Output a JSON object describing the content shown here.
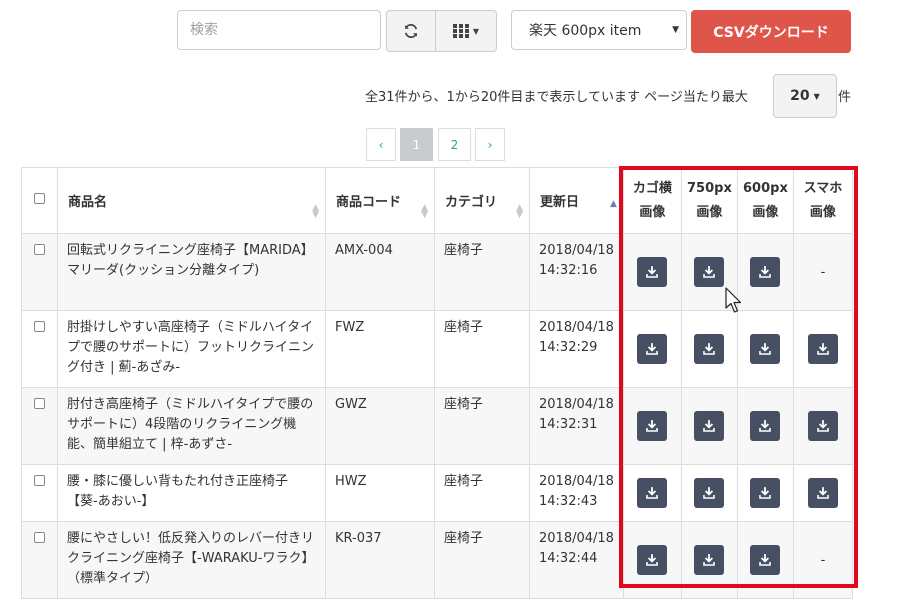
{
  "toolbar": {
    "search_placeholder": "検索",
    "refresh_icon": "refresh-icon",
    "columns_icon": "grid-icon",
    "select_value": "楽天 600px item",
    "csv_button": "CSVダウンロード"
  },
  "info": {
    "text": "全31件から、1から20件目まで表示しています ページ当たり最大",
    "page_size": "20",
    "suffix": "件"
  },
  "pagination": {
    "prev": "‹",
    "pages": [
      "1",
      "2"
    ],
    "next": "›",
    "active": "1"
  },
  "table": {
    "headers": {
      "name": "商品名",
      "code": "商品コード",
      "category": "カテゴリ",
      "updated": "更新日",
      "cart": [
        "カゴ横",
        "画像"
      ],
      "w750": [
        "750px",
        "画像"
      ],
      "w600": [
        "600px",
        "画像"
      ],
      "sp": [
        "スマホ",
        "画像"
      ]
    },
    "rows": [
      {
        "name": "回転式リクライニング座椅子【MARIDA】マリーダ(クッション分離タイプ)",
        "code": "AMX-004",
        "category": "座椅子",
        "date": "2018/04/18",
        "time": "14:32:16",
        "images": [
          true,
          true,
          true,
          false
        ]
      },
      {
        "name": "肘掛けしやすい高座椅子（ミドルハイタイプで腰のサポートに）フットリクライニング付き | 薊-あざみ-",
        "code": "FWZ",
        "category": "座椅子",
        "date": "2018/04/18",
        "time": "14:32:29",
        "images": [
          true,
          true,
          true,
          true
        ]
      },
      {
        "name": "肘付き高座椅子（ミドルハイタイプで腰のサポートに）4段階のリクライニング機能、簡単組立て | 梓-あずさ-",
        "code": "GWZ",
        "category": "座椅子",
        "date": "2018/04/18",
        "time": "14:32:31",
        "images": [
          true,
          true,
          true,
          true
        ]
      },
      {
        "name": "腰・膝に優しい背もたれ付き正座椅子【葵-あおい-】",
        "code": "HWZ",
        "category": "座椅子",
        "date": "2018/04/18",
        "time": "14:32:43",
        "images": [
          true,
          true,
          true,
          true
        ]
      },
      {
        "name": "腰にやさしい！低反発入りのレバー付きリクライニング座椅子【-WARAKU-ワラク】（標準タイプ）",
        "code": "KR-037",
        "category": "座椅子",
        "date": "2018/04/18",
        "time": "14:32:44",
        "images": [
          true,
          true,
          true,
          false
        ]
      }
    ],
    "missing_image": "-"
  },
  "colors": {
    "csv_button": "#e0554a",
    "download_button": "#475063",
    "highlight": "#e2081b",
    "pagination_active": "#c7ccd1",
    "link": "#2aa198"
  }
}
